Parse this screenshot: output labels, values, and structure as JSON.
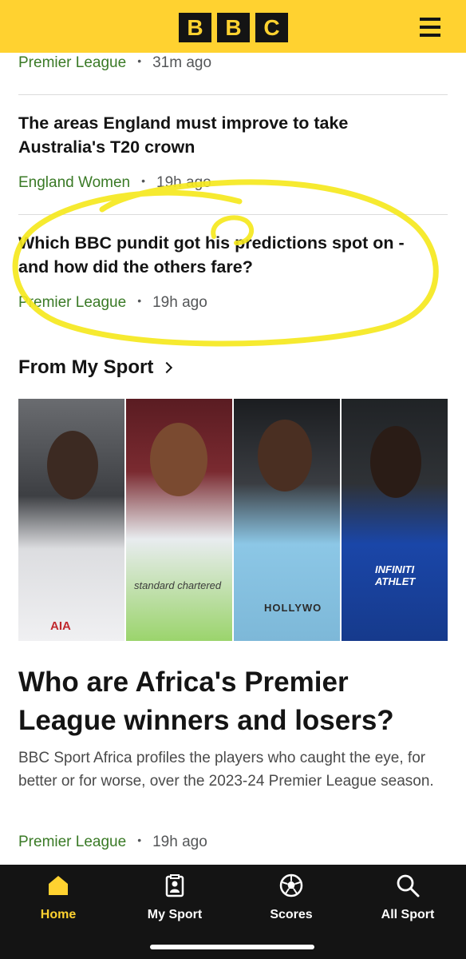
{
  "header": {
    "logo_letters": [
      "B",
      "B",
      "C"
    ],
    "menu_icon": "hamburger-menu-icon",
    "colors": {
      "brand_yellow": "#FFD230",
      "dark": "#141414"
    }
  },
  "feed": {
    "top_meta": {
      "section": "Premier League",
      "time": "31m ago"
    },
    "articles": [
      {
        "headline": "The areas England must improve to take Australia's T20 crown",
        "section": "England Women",
        "time": "19h ago"
      },
      {
        "headline": "Which BBC pundit got his predictions spot on - and how did the others fare?",
        "section": "Premier League",
        "time": "19h ago"
      }
    ]
  },
  "my_sport": {
    "title": "From My Sport",
    "chevron_icon": "chevron-right-icon",
    "photos": [
      {
        "name": "player-photo-1",
        "shirt_text": "AIA"
      },
      {
        "name": "player-photo-2",
        "shirt_text": "standard chartered"
      },
      {
        "name": "player-photo-3",
        "shirt_text": "HOLLYWO"
      },
      {
        "name": "player-photo-4",
        "shirt_text": "INFINITI ATHLET"
      }
    ],
    "feature": {
      "headline": "Who are Africa's Premier League winners and losers?",
      "summary": "BBC Sport Africa profiles the players who caught the eye, for better or for worse, over the 2023-24 Premier League season.",
      "section": "Premier League",
      "time": "19h ago"
    }
  },
  "bottom_nav": {
    "items": [
      {
        "label": "Home",
        "icon": "home-icon",
        "active": true
      },
      {
        "label": "My Sport",
        "icon": "my-sport-icon",
        "active": false
      },
      {
        "label": "Scores",
        "icon": "football-icon",
        "active": false
      },
      {
        "label": "All Sport",
        "icon": "search-icon",
        "active": false
      }
    ],
    "colors": {
      "active": "#FFD230",
      "inactive": "#ffffff",
      "background": "#141414"
    }
  },
  "annotation": {
    "color": "#F5E81E"
  }
}
